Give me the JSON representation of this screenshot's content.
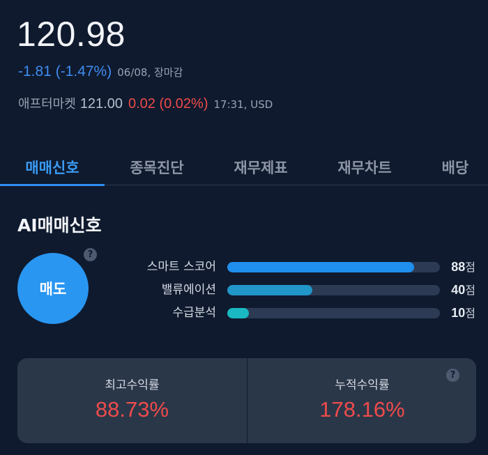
{
  "quote": {
    "price": "120.98",
    "change": "-1.81 (-1.47%)",
    "change_meta": "06/08, 장마감",
    "after_label": "애프터마켓",
    "after_price": "121.00",
    "after_change": "0.02 (0.02%)",
    "after_meta": "17:31, USD"
  },
  "tabs": [
    {
      "label": "매매신호",
      "active": true
    },
    {
      "label": "종목진단"
    },
    {
      "label": "재무제표"
    },
    {
      "label": "재무차트"
    },
    {
      "label": "배당"
    }
  ],
  "signal": {
    "title": "AI매매신호",
    "help_icon": "?",
    "badge": "매도",
    "scores": [
      {
        "label": "스마트 스코어",
        "value": 88,
        "value_text": "88",
        "unit": "점",
        "color": "#1e8fee"
      },
      {
        "label": "밸류에이션",
        "value": 40,
        "value_text": "40",
        "unit": "점",
        "color": "#2196c9"
      },
      {
        "label": "수급분석",
        "value": 10,
        "value_text": "10",
        "unit": "점",
        "color": "#19b8c2"
      }
    ]
  },
  "returns": {
    "max_label": "최고수익률",
    "max_value": "88.73%",
    "cum_label": "누적수익률",
    "cum_value": "178.16%",
    "help_icon": "?"
  },
  "colors": {
    "background": "#0f1a2e",
    "accent": "#2f8df0",
    "down": "#3f8cf0",
    "up": "#ef4b4b"
  }
}
